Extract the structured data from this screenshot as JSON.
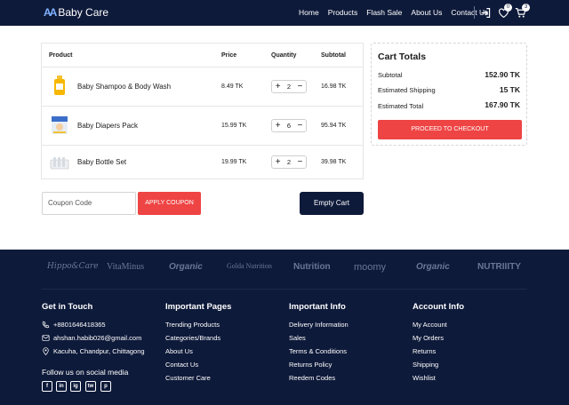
{
  "header": {
    "logo_mark": "AA",
    "logo_text": "Baby Care",
    "nav": [
      "Home",
      "Products",
      "Flash Sale",
      "About Us",
      "Contact Us"
    ],
    "wishlist_count": "0",
    "cart_count": "3"
  },
  "cart": {
    "columns": [
      "Product",
      "Price",
      "Quantity",
      "Subtotal"
    ],
    "items": [
      {
        "name": "Baby Shampoo & Body Wash",
        "price": "8.49 TK",
        "qty": "2",
        "subtotal": "16.98 TK"
      },
      {
        "name": "Baby Diapers Pack",
        "price": "15.99 TK",
        "qty": "6",
        "subtotal": "95.94 TK"
      },
      {
        "name": "Baby Bottle Set",
        "price": "19.99 TK",
        "qty": "2",
        "subtotal": "39.98 TK"
      }
    ],
    "minus": "−",
    "plus": "+"
  },
  "coupon": {
    "placeholder": "Coupon Code",
    "apply_label": "APPLY COUPON"
  },
  "empty_cart_label": "Empty Cart",
  "totals": {
    "title": "Cart Totals",
    "rows": [
      {
        "label": "Subtotal",
        "value": "152.90 TK"
      },
      {
        "label": "Estimated Shipping",
        "value": "15 TK"
      },
      {
        "label": "Estimated Total",
        "value": "167.90 TK"
      }
    ],
    "checkout_label": "PROCEED TO CHECKOUT"
  },
  "footer": {
    "brands": [
      "Hippo&Care",
      "VitaMinus",
      "Organic",
      "Golda Nutrition",
      "Nutrition",
      "moomy",
      "Organic",
      "NUTRIIITY"
    ],
    "contact": {
      "title": "Get in Touch",
      "phone": "+8801646418365",
      "email": "ahshan.habib026@gmail.com",
      "address": "Kacuha, Chandpur, Chittagong",
      "follow": "Follow us on social media"
    },
    "columns": [
      {
        "title": "Important Pages",
        "items": [
          "Trending Products",
          "Categories/Brands",
          "About Us",
          "Contact Us",
          "Customer Care"
        ]
      },
      {
        "title": "Important Info",
        "items": [
          "Delivery Information",
          "Sales",
          "Terms & Conditions",
          "Returns Policy",
          "Reedem Codes"
        ]
      },
      {
        "title": "Account Info",
        "items": [
          "My Account",
          "My Orders",
          "Returns",
          "Shipping",
          "Wishlist"
        ]
      }
    ],
    "social": [
      "f",
      "in",
      "ig",
      "tw",
      "p"
    ]
  }
}
